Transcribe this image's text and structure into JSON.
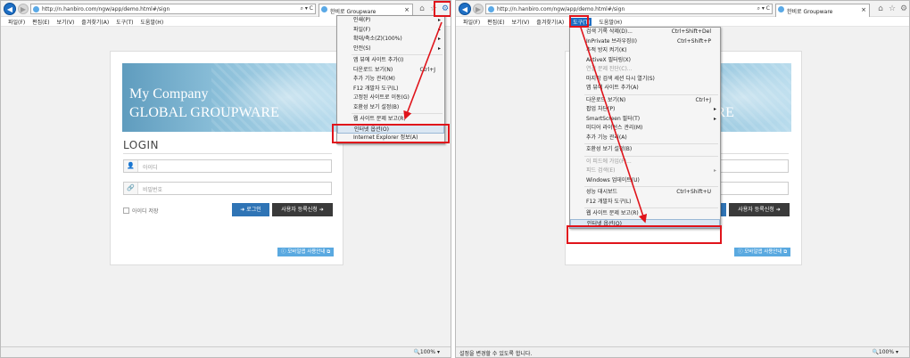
{
  "left": {
    "url": "http://n.hanbiro.com/ngw/app/demo.html#/sign",
    "url_controls": "⌕ ▾ C",
    "tab_title": "한비로 Groupware",
    "menubar": [
      "파일(F)",
      "편집(E)",
      "보기(V)",
      "즐겨찾기(A)",
      "도구(T)",
      "도움말(H)"
    ],
    "gear_menu": [
      {
        "label": "인쇄(P)",
        "sub": "▸"
      },
      {
        "label": "파일(F)",
        "sub": "▸"
      },
      {
        "label": "확대/축소(Z)(100%)",
        "sub": "▸"
      },
      {
        "label": "안전(S)",
        "sub": "▸"
      },
      {
        "sep": true
      },
      {
        "label": "앱 뷰에 사이트 추가(I)"
      },
      {
        "label": "다운로드 보기(N)",
        "shortcut": "Ctrl+J"
      },
      {
        "label": "추가 기능 관리(M)"
      },
      {
        "label": "F12 개발자 도구(L)"
      },
      {
        "label": "고정된 사이트로 이동(G)"
      },
      {
        "label": "호환성 보기 설정(B)"
      },
      {
        "sep": true
      },
      {
        "label": "웹 사이트 문제 보고(R)"
      },
      {
        "label": "인터넷 옵션(O)",
        "selected": true
      },
      {
        "label": "Internet Explorer 정보(A)"
      }
    ]
  },
  "right": {
    "url": "http://n.hanbiro.com/ngw/app/demo.html#/sign",
    "url_controls": "⌕ ▾ C",
    "tab_title": "한비로 Groupware",
    "menubar": [
      "파일(F)",
      "편집(E)",
      "보기(V)",
      "즐겨찾기(A)",
      "도구(T)",
      "도움말(H)"
    ],
    "tools_menu": [
      {
        "label": "검색 기록 삭제(D)...",
        "shortcut": "Ctrl+Shift+Del"
      },
      {
        "label": "InPrivate 브라우징(I)",
        "shortcut": "Ctrl+Shift+P"
      },
      {
        "label": "추적 방지 켜기(K)"
      },
      {
        "label": "ActiveX 필터링(X)"
      },
      {
        "label": "연결 문제 진단(C)...",
        "disabled": true
      },
      {
        "label": "마지막 검색 세션 다시 열기(S)"
      },
      {
        "label": "앱 뷰에 사이트 추가(A)"
      },
      {
        "sep": true
      },
      {
        "label": "다운로드 보기(N)",
        "shortcut": "Ctrl+J"
      },
      {
        "label": "팝업 차단(P)",
        "sub": "▸"
      },
      {
        "label": "SmartScreen 필터(T)",
        "sub": "▸"
      },
      {
        "label": "미디어 라이선스 관리(M)"
      },
      {
        "label": "추가 기능 관리(A)"
      },
      {
        "sep": true
      },
      {
        "label": "호환성 보기 설정(B)"
      },
      {
        "sep": true
      },
      {
        "label": "이 피드에 가입(F)...",
        "disabled": true
      },
      {
        "label": "피드 검색(E)",
        "sub": "▸",
        "disabled": true
      },
      {
        "label": "Windows 업데이트(U)"
      },
      {
        "sep": true
      },
      {
        "label": "성능 대시보드",
        "shortcut": "Ctrl+Shift+U"
      },
      {
        "label": "F12 개발자 도구(L)"
      },
      {
        "sep": true
      },
      {
        "label": "웹 사이트 문제 보고(R)"
      },
      {
        "label": "인터넷 옵션(O)",
        "selected": true
      }
    ],
    "status_text": "설정을 변경할 수 있도록 합니다."
  },
  "login": {
    "banner_line1": "My Company",
    "banner_line2": "GLOBAL GROUPWARE",
    "heading": "LOGIN",
    "id_placeholder": "아이디",
    "pw_placeholder": "비밀번호",
    "remember": "아이디 저장",
    "login_btn": "➜ 로그인",
    "register_btn": "사용자 등록신청 ➜",
    "mobile_link": "ⓘ 모바일앱 사용안내 ⧉"
  },
  "zoom": "🔍100%  ▾",
  "colors": {
    "accent": "#1e6fc4",
    "highlight": "#e0141b",
    "login_btn": "#2f74b5",
    "register_btn": "#3a3a3a"
  }
}
